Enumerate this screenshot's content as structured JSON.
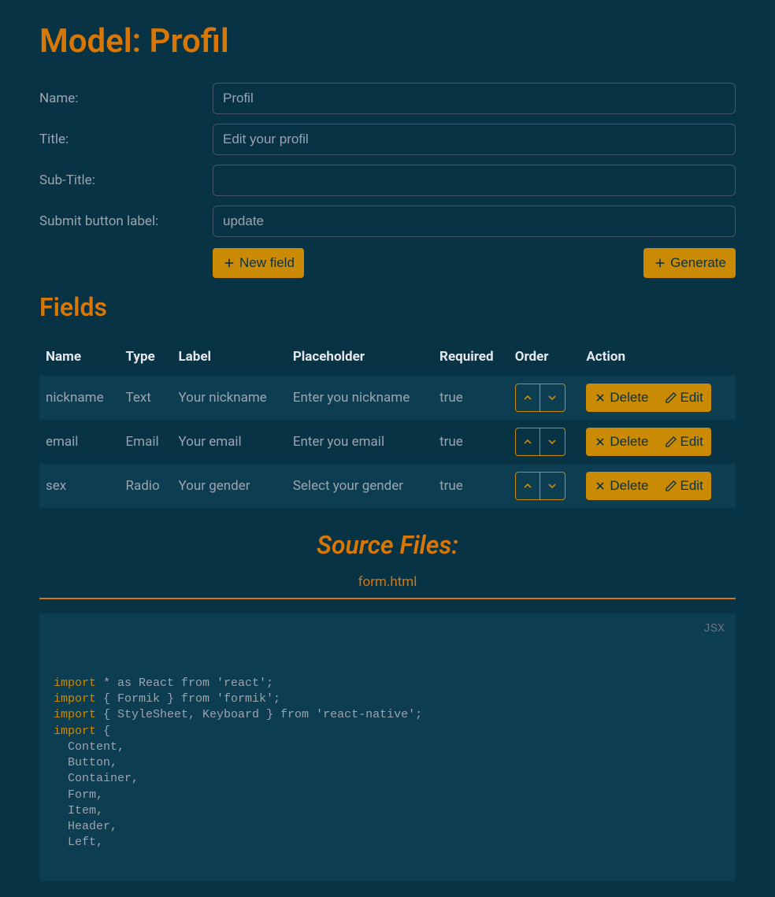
{
  "page_title": "Model: Profil",
  "form": {
    "name_label": "Name:",
    "name_value": "Profil",
    "title_label": "Title:",
    "title_value": "Edit your profil",
    "subtitle_label": "Sub-Title:",
    "subtitle_value": "",
    "submit_label": "Submit button label:",
    "submit_value": "update"
  },
  "buttons": {
    "new_field": "New field",
    "generate": "Generate",
    "delete": "Delete",
    "edit": "Edit"
  },
  "fields_section_title": "Fields",
  "table": {
    "headers": {
      "name": "Name",
      "type": "Type",
      "label": "Label",
      "placeholder": "Placeholder",
      "required": "Required",
      "order": "Order",
      "action": "Action"
    },
    "rows": [
      {
        "name": "nickname",
        "type": "Text",
        "label": "Your nickname",
        "placeholder": "Enter you nickname",
        "required": "true"
      },
      {
        "name": "email",
        "type": "Email",
        "label": "Your email",
        "placeholder": "Enter you email",
        "required": "true"
      },
      {
        "name": "sex",
        "type": "Radio",
        "label": "Your gender",
        "placeholder": "Select your gender",
        "required": "true"
      }
    ]
  },
  "source": {
    "title": "Source Files:",
    "file_tab": "form.html",
    "lang": "JSX",
    "code_lines": [
      {
        "kw": "import",
        "rest": " * as React from 'react';"
      },
      {
        "kw": "import",
        "rest": " { Formik } from 'formik';"
      },
      {
        "kw": "import",
        "rest": " { StyleSheet, Keyboard } from 'react-native';"
      },
      {
        "kw": "import",
        "rest": " {"
      },
      {
        "kw": "",
        "rest": "  Content,"
      },
      {
        "kw": "",
        "rest": "  Button,"
      },
      {
        "kw": "",
        "rest": "  Container,"
      },
      {
        "kw": "",
        "rest": "  Form,"
      },
      {
        "kw": "",
        "rest": "  Item,"
      },
      {
        "kw": "",
        "rest": "  Header,"
      },
      {
        "kw": "",
        "rest": "  Left,"
      }
    ]
  },
  "colors": {
    "accent": "#ca8a04",
    "heading": "#d97706",
    "bg": "#083344"
  }
}
